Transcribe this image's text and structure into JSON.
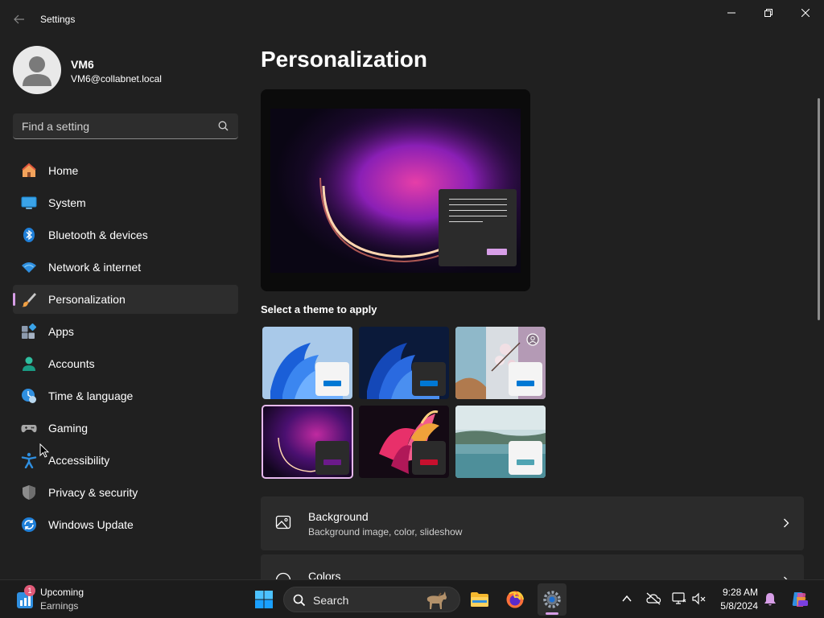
{
  "window": {
    "title": "Settings",
    "back_icon": "back-arrow-icon",
    "controls": [
      "minimize-icon",
      "restore-icon",
      "close-icon"
    ]
  },
  "profile": {
    "name": "VM6",
    "email": "VM6@collabnet.local"
  },
  "search": {
    "placeholder": "Find a setting"
  },
  "nav": {
    "items": [
      {
        "label": "Home",
        "icon": "home-icon"
      },
      {
        "label": "System",
        "icon": "system-icon"
      },
      {
        "label": "Bluetooth & devices",
        "icon": "bluetooth-icon"
      },
      {
        "label": "Network & internet",
        "icon": "network-icon"
      },
      {
        "label": "Personalization",
        "icon": "brush-icon",
        "active": true
      },
      {
        "label": "Apps",
        "icon": "apps-icon"
      },
      {
        "label": "Accounts",
        "icon": "accounts-icon"
      },
      {
        "label": "Time & language",
        "icon": "time-language-icon"
      },
      {
        "label": "Gaming",
        "icon": "gaming-icon"
      },
      {
        "label": "Accessibility",
        "icon": "accessibility-icon"
      },
      {
        "label": "Privacy & security",
        "icon": "shield-icon"
      },
      {
        "label": "Windows Update",
        "icon": "update-icon"
      }
    ]
  },
  "main": {
    "title": "Personalization",
    "theme_heading": "Select a theme to apply",
    "themes": [
      {
        "name": "windows-light",
        "accent": "#0078d4"
      },
      {
        "name": "windows-dark",
        "accent": "#0078d4"
      },
      {
        "name": "spotlight",
        "accent": "#0078d4"
      },
      {
        "name": "glow",
        "accent": "#6b1a8a",
        "selected": true
      },
      {
        "name": "captured-motion",
        "accent": "#c8102e"
      },
      {
        "name": "flow",
        "accent": "#4fa4b3"
      }
    ],
    "cards": [
      {
        "title": "Background",
        "subtitle": "Background image, color, slideshow",
        "icon": "image-icon"
      },
      {
        "title": "Colors",
        "subtitle": "",
        "icon": "palette-icon"
      }
    ]
  },
  "taskbar": {
    "weather_title": "Upcoming",
    "weather_sub": "Earnings",
    "weather_badge": "1",
    "search_label": "Search",
    "time": "9:28 AM",
    "date": "5/8/2024",
    "pinned": [
      "start-icon",
      "file-explorer-icon",
      "firefox-icon",
      "settings-app-icon"
    ],
    "tray": [
      "chevron-up-icon",
      "cloud-off-icon",
      "network-tray-icon",
      "volume-muted-icon",
      "notification-bell-icon",
      "copilot-icon"
    ]
  },
  "colors": {
    "accent": "#d79ee7",
    "background": "#202020",
    "card": "#2b2b2b"
  }
}
